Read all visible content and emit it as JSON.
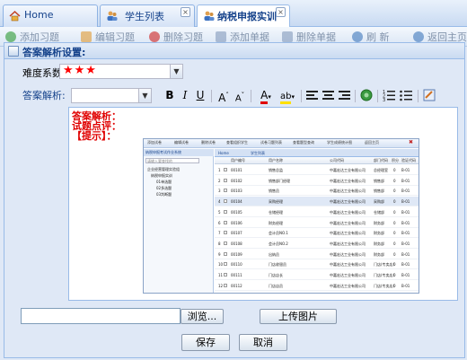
{
  "tabs": [
    {
      "label": "Home"
    },
    {
      "label": "学生列表"
    },
    {
      "label": "纳税申报实训"
    }
  ],
  "toolbar": {
    "add_label": "添加习题",
    "edit_label": "编辑习题",
    "delete_label": "删除习题",
    "add_sheet_label": "添加单据",
    "delete_sheet_label": "删除单据",
    "refresh_label": "刷 新",
    "back_label": "返回主页"
  },
  "dialog": {
    "title": "答案解析设置:",
    "difficulty_label": "难度系数:",
    "difficulty_value": "★★★",
    "analysis_label": "答案解析:",
    "content_lines": [
      "答案解析：",
      "试题点评：",
      "【提示】："
    ],
    "browse_label": "浏览...",
    "upload_label": "上传图片",
    "save_label": "保存",
    "cancel_label": "取消"
  },
  "embedded": {
    "toolbar": [
      "添加试卷",
      "编辑试卷",
      "删除试卷",
      "查看组织学生",
      "试卷习题列表",
      "查看题型查询",
      "学生成绩统计图",
      "返回主页"
    ],
    "sidebar_title": "纳税申报考试作业系统",
    "search_placeholder": "请输入要查找的",
    "tree": [
      "企业经营管理实验组",
      "纳税申报实训",
      "01单选题",
      "02多选题",
      "03判断题"
    ],
    "tabs": [
      "Home",
      "学生列表"
    ],
    "columns": [
      "用户编号",
      "用户名称",
      "公司代码",
      "部门代码",
      "积分",
      "验证代码"
    ],
    "rows": [
      [
        "00101",
        "销售总监",
        "中嘉宏达工业有限公司",
        "总经理室",
        "0",
        "B-01"
      ],
      [
        "00102",
        "销售部门经理",
        "中嘉宏达工业有限公司",
        "销售部",
        "0",
        "B-01"
      ],
      [
        "00103",
        "销售员",
        "中嘉宏达工业有限公司",
        "销售部",
        "0",
        "B-01"
      ],
      [
        "00104",
        "采购经理",
        "中嘉宏达工业有限公司",
        "采购部",
        "0",
        "B-01"
      ],
      [
        "00105",
        "仓储经理",
        "中嘉宏达工业有限公司",
        "仓储部",
        "0",
        "B-01"
      ],
      [
        "00106",
        "财务经理",
        "中嘉宏达工业有限公司",
        "财务部",
        "0",
        "B-01"
      ],
      [
        "00107",
        "会计员NO.1",
        "中嘉宏达工业有限公司",
        "财务部",
        "0",
        "B-01"
      ],
      [
        "00108",
        "会计员NO.2",
        "中嘉宏达工业有限公司",
        "财务部",
        "0",
        "B-01"
      ],
      [
        "00109",
        "出纳员",
        "中嘉宏达工业有限公司",
        "财务部",
        "0",
        "B-01"
      ],
      [
        "00110",
        "门店收银员",
        "中嘉宏达工业有限公司",
        "门店(专卖店)",
        "0",
        "B-01"
      ],
      [
        "00111",
        "门店店长",
        "中嘉宏达工业有限公司",
        "门店(专卖店)",
        "0",
        "B-01"
      ],
      [
        "00112",
        "门店店员",
        "中嘉宏达工业有限公司",
        "门店(专卖店)",
        "0",
        "B-01"
      ]
    ]
  },
  "colors": {
    "accent": "#15428b",
    "window_bg": "#dfe8f6",
    "highlight_red": "#e00000"
  }
}
